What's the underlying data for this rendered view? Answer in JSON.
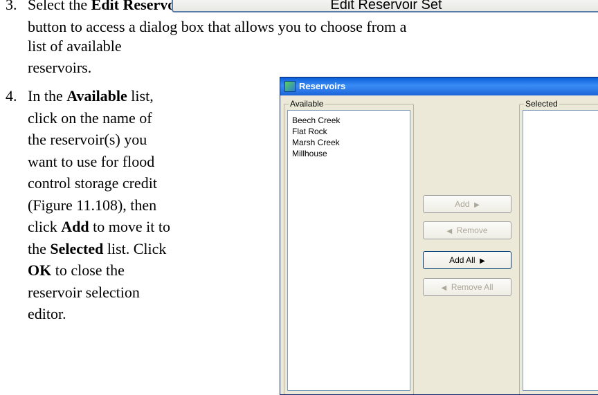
{
  "steps": [
    {
      "number": "3.",
      "line1_pre": "Select the ",
      "line1_bold": "Edit Reservoir Set",
      "button_image_label": "Edit Reservoir Set",
      "line2": "button to access a dialog box that allows you to choose from a",
      "line3": "list of available",
      "line4": "reservoirs."
    },
    {
      "number": "4.",
      "lines": [
        {
          "pre": "In the ",
          "bold": "Available",
          "post": " list,"
        },
        {
          "pre": "click on the name of",
          "bold": "",
          "post": ""
        },
        {
          "pre": "the reservoir(s) you",
          "bold": "",
          "post": ""
        },
        {
          "pre": "want to use for flood",
          "bold": "",
          "post": ""
        },
        {
          "pre": "control storage credit",
          "bold": "",
          "post": ""
        },
        {
          "pre": "(Figure 11.108), then",
          "bold": "",
          "post": ""
        },
        {
          "pre": "click ",
          "bold": "Add",
          "post": " to move it to"
        },
        {
          "pre": "the ",
          "bold": "Selected",
          "post": " list.  Click"
        },
        {
          "pre": "",
          "bold": "OK",
          "post": " to close the"
        },
        {
          "pre": "reservoir selection",
          "bold": "",
          "post": ""
        },
        {
          "pre": "editor.",
          "bold": "",
          "post": ""
        }
      ]
    }
  ],
  "dialog": {
    "title": "Reservoirs",
    "available_label": "Available",
    "selected_label": "Selected",
    "available_items": [
      "Beech Creek",
      "Flat Rock",
      "Marsh Creek",
      "Millhouse"
    ],
    "buttons": {
      "add": "Add",
      "remove": "Remove",
      "add_all": "Add All",
      "remove_all": "Remove All"
    }
  }
}
